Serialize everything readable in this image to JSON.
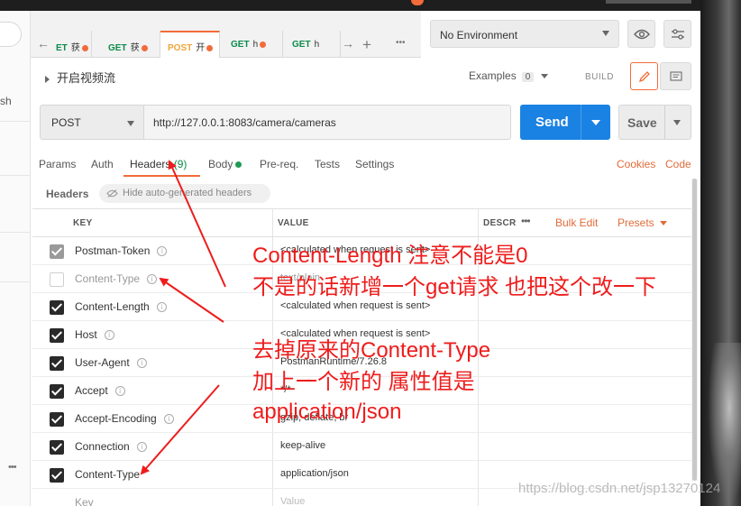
{
  "tabs": {
    "items": [
      {
        "method": "ET",
        "name": "获"
      },
      {
        "method": "GET",
        "name": "获"
      },
      {
        "method": "POST",
        "name": "开"
      },
      {
        "method": "GET",
        "name": "h"
      },
      {
        "method": "GET",
        "name": "h"
      }
    ],
    "more": "•••"
  },
  "environment": {
    "selected": "No Environment"
  },
  "sidebar": {
    "fragment": "sh"
  },
  "request": {
    "title": "开启视频流",
    "examples_label": "Examples",
    "examples_count": "0",
    "build_label": "BUILD",
    "method": "POST",
    "url": "http://127.0.0.1:8083/camera/cameras",
    "send_label": "Send",
    "save_label": "Save"
  },
  "subtabs": {
    "params": "Params",
    "auth": "Auth",
    "headers": "Headers",
    "headers_count": "(9)",
    "body": "Body",
    "prereq": "Pre-req.",
    "tests": "Tests",
    "settings": "Settings",
    "cookies": "Cookies",
    "code": "Code"
  },
  "headers_section": {
    "label": "Headers",
    "hide_auto": "Hide auto-generated headers"
  },
  "table": {
    "col_key": "KEY",
    "col_value": "VALUE",
    "col_desc": "DESCR",
    "bulk_edit": "Bulk Edit",
    "presets": "Presets",
    "rows": [
      {
        "key": "Postman-Token",
        "value": "<calculated when request is sent>",
        "state": "grey"
      },
      {
        "key": "Content-Type",
        "value": "text/plain",
        "state": "off"
      },
      {
        "key": "Content-Length",
        "value": "<calculated when request is sent>",
        "state": "on"
      },
      {
        "key": "Host",
        "value": "<calculated when request is sent>",
        "state": "on"
      },
      {
        "key": "User-Agent",
        "value": "PostmanRuntime/7.26.8",
        "state": "on"
      },
      {
        "key": "Accept",
        "value": "*/*",
        "state": "on"
      },
      {
        "key": "Accept-Encoding",
        "value": "gzip, deflate, br",
        "state": "on"
      },
      {
        "key": "Connection",
        "value": "keep-alive",
        "state": "on"
      },
      {
        "key": "Content-Type",
        "value": "application/json",
        "state": "on"
      },
      {
        "key": "Key",
        "value": "Value",
        "state": "none"
      }
    ]
  },
  "annotations": {
    "line1": "Content-Length 注意不能是0",
    "line2": "不是的话新增一个get请求 也把这个改一下",
    "line3": "去掉原来的Content-Type",
    "line4": "加上一个新的 属性值是",
    "line5": "application/json"
  },
  "watermark": "https://blog.csdn.net/jsp13270124",
  "colors": {
    "accent": "#f26b3a",
    "send": "#1a82e2",
    "annotation": "#ee1c1c",
    "get": "#0b8a4b",
    "post": "#f0a53b"
  }
}
